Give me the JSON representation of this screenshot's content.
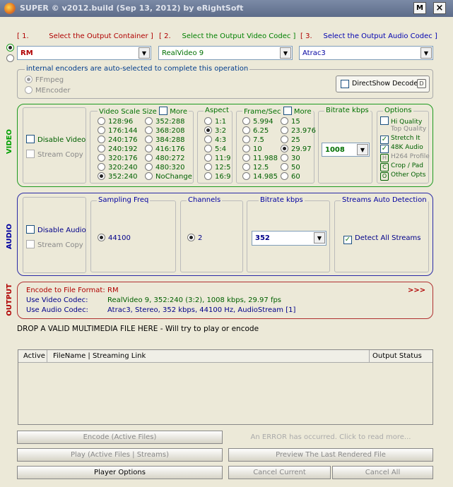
{
  "title": "SUPER © v2012.build (Sep 13, 2012) by eRightSoft",
  "window_buttons": {
    "min": "M",
    "close": "×"
  },
  "steps": [
    {
      "num": "[ 1.",
      "text": "Select the Output Container ]"
    },
    {
      "num": "[ 2.",
      "text": "Select the Output Video Codec ]"
    },
    {
      "num": "[ 3.",
      "text": "Select the Output Audio Codec ]"
    }
  ],
  "container": "RM",
  "video_codec": "RealVideo 9",
  "audio_codec": "Atrac3",
  "encoders": {
    "legend": "internal encoders are auto-selected to complete this operation",
    "ffmpeg": "FFmpeg",
    "mencoder": "MEncoder",
    "directshow": "DirectShow Decode",
    "directshow_key": "D"
  },
  "video": {
    "section": "VIDEO",
    "disable": "Disable Video",
    "stream_copy": "Stream Copy",
    "scale_title": "Video Scale Size",
    "more": "More",
    "scale_col1": [
      "128:96",
      "176:144",
      "240:176",
      "240:192",
      "320:176",
      "320:240",
      "352:240"
    ],
    "scale_col2": [
      "352:288",
      "368:208",
      "384:288",
      "416:176",
      "480:272",
      "480:320",
      "NoChange"
    ],
    "scale_selected": "352:240",
    "aspect_title": "Aspect",
    "aspects": [
      "1:1",
      "3:2",
      "4:3",
      "5:4",
      "11:9",
      "12:5",
      "16:9"
    ],
    "aspect_selected": "3:2",
    "fps_title": "Frame/Sec",
    "fps_col1": [
      "5.994",
      "6.25",
      "7.5",
      "10",
      "11.988",
      "12.5",
      "14.985"
    ],
    "fps_col2": [
      "15",
      "23.976",
      "25",
      "29.97",
      "30",
      "50",
      "60"
    ],
    "fps_selected": "29.97",
    "bitrate_title": "Bitrate  kbps",
    "bitrate": "1008",
    "options_title": "Options",
    "options": [
      {
        "label": "Hi Quality",
        "type": "check",
        "checked": false
      },
      {
        "label": "Top Quality",
        "type": "text"
      },
      {
        "label": "Stretch It",
        "type": "check",
        "checked": true
      },
      {
        "label": "48K Audio",
        "type": "check",
        "checked": true
      },
      {
        "label": "H264 Profile",
        "type": "key",
        "key": "H"
      },
      {
        "label": "Crop / Pad",
        "type": "key",
        "key": "C"
      },
      {
        "label": "Other Opts",
        "type": "key",
        "key": "O"
      }
    ]
  },
  "audio": {
    "section": "AUDIO",
    "disable": "Disable Audio",
    "stream_copy": "Stream Copy",
    "sampling_title": "Sampling Freq",
    "sampling": "44100",
    "channels_title": "Channels",
    "channels": "2",
    "bitrate_title": "Bitrate  kbps",
    "bitrate": "352",
    "streams_title": "Streams Auto Detection",
    "detect": "Detect All Streams"
  },
  "output": {
    "section": "OUTPUT",
    "rows": [
      {
        "label": "Encode to File Format:",
        "value": "RM"
      },
      {
        "label": "Use Video Codec:",
        "value": "RealVideo 9,  352:240 (3:2),  1008 kbps,  29.97 fps"
      },
      {
        "label": "Use Audio Codec:",
        "value": "Atrac3,  Stereo,  352 kbps,  44100 Hz,  AudioStream [1]"
      }
    ],
    "more": ">>>"
  },
  "drop_text": "DROP A VALID MULTIMEDIA FILE HERE - Will try to play or encode",
  "table": {
    "col_active": "Active",
    "col_file": "FileName  |  Streaming Link",
    "col_status": "Output Status"
  },
  "buttons": {
    "encode": "Encode (Active Files)",
    "error": "An ERROR has occurred. Click to read more...",
    "play": "Play (Active Files | Streams)",
    "preview": "Preview The Last Rendered File",
    "player_options": "Player Options",
    "cancel_current": "Cancel Current",
    "cancel_all": "Cancel All"
  }
}
